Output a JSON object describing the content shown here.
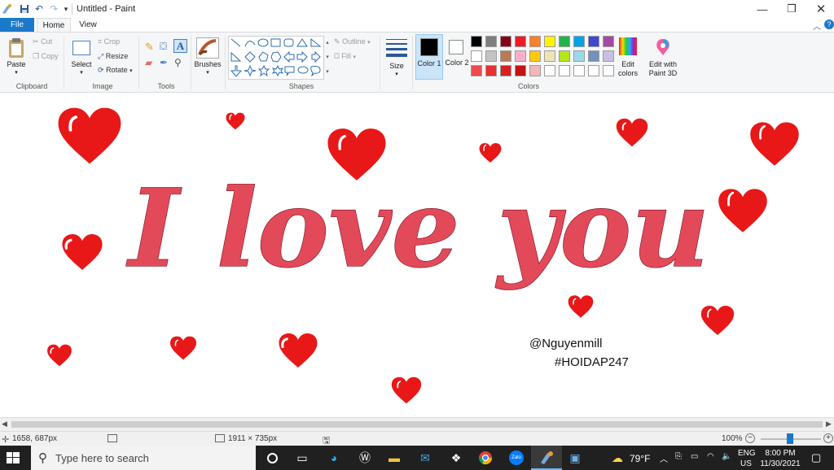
{
  "window": {
    "title": "Untitled - Paint"
  },
  "tabs": {
    "file": "File",
    "home": "Home",
    "view": "View"
  },
  "clipboard": {
    "paste": "Paste",
    "cut": "Cut",
    "copy": "Copy",
    "label": "Clipboard"
  },
  "image": {
    "select": "Select",
    "crop": "Crop",
    "resize": "Resize",
    "rotate": "Rotate",
    "label": "Image"
  },
  "tools": {
    "label": "Tools"
  },
  "brushes": {
    "label": "Brushes"
  },
  "shapes": {
    "outline": "Outline",
    "fill": "Fill",
    "label": "Shapes"
  },
  "size": {
    "label": "Size"
  },
  "colors": {
    "color1_label": "Color 1",
    "color2_label": "Color 2",
    "color1": "#000000",
    "color2": "#ffffff",
    "edit_colors": "Edit colors",
    "edit_3d": "Edit with Paint 3D",
    "label": "Colors",
    "palette_row1": [
      "#000000",
      "#7f7f7f",
      "#880015",
      "#ed1c24",
      "#ff7f27",
      "#fff200",
      "#22b14c",
      "#00a2e8",
      "#3f48cc",
      "#a349a4"
    ],
    "palette_row2": [
      "#ffffff",
      "#c3c3c3",
      "#b97a57",
      "#ffaec9",
      "#ffc90e",
      "#efe4b0",
      "#b5e61d",
      "#99d9ea",
      "#7092be",
      "#c8bfe7"
    ],
    "palette_row3": [
      "#ef4b4b",
      "#e83030",
      "#d81f1f",
      "#c41212",
      "#f4b6b6",
      "#ffffff",
      "#ffffff",
      "#ffffff",
      "#ffffff",
      "#ffffff"
    ]
  },
  "canvas": {
    "main_text": "I love you",
    "signature": "@Nguyenmill",
    "hashtag": "#HOIDAP247",
    "heart_color": "#e81818"
  },
  "status": {
    "cursor": "1658, 687px",
    "canvas_size": "1911 × 735px",
    "zoom": "100%"
  },
  "taskbar": {
    "search_placeholder": "Type here to search",
    "weather": "79°F",
    "lang": "ENG",
    "region": "US",
    "time": "8:00 PM",
    "date": "11/30/2021"
  }
}
